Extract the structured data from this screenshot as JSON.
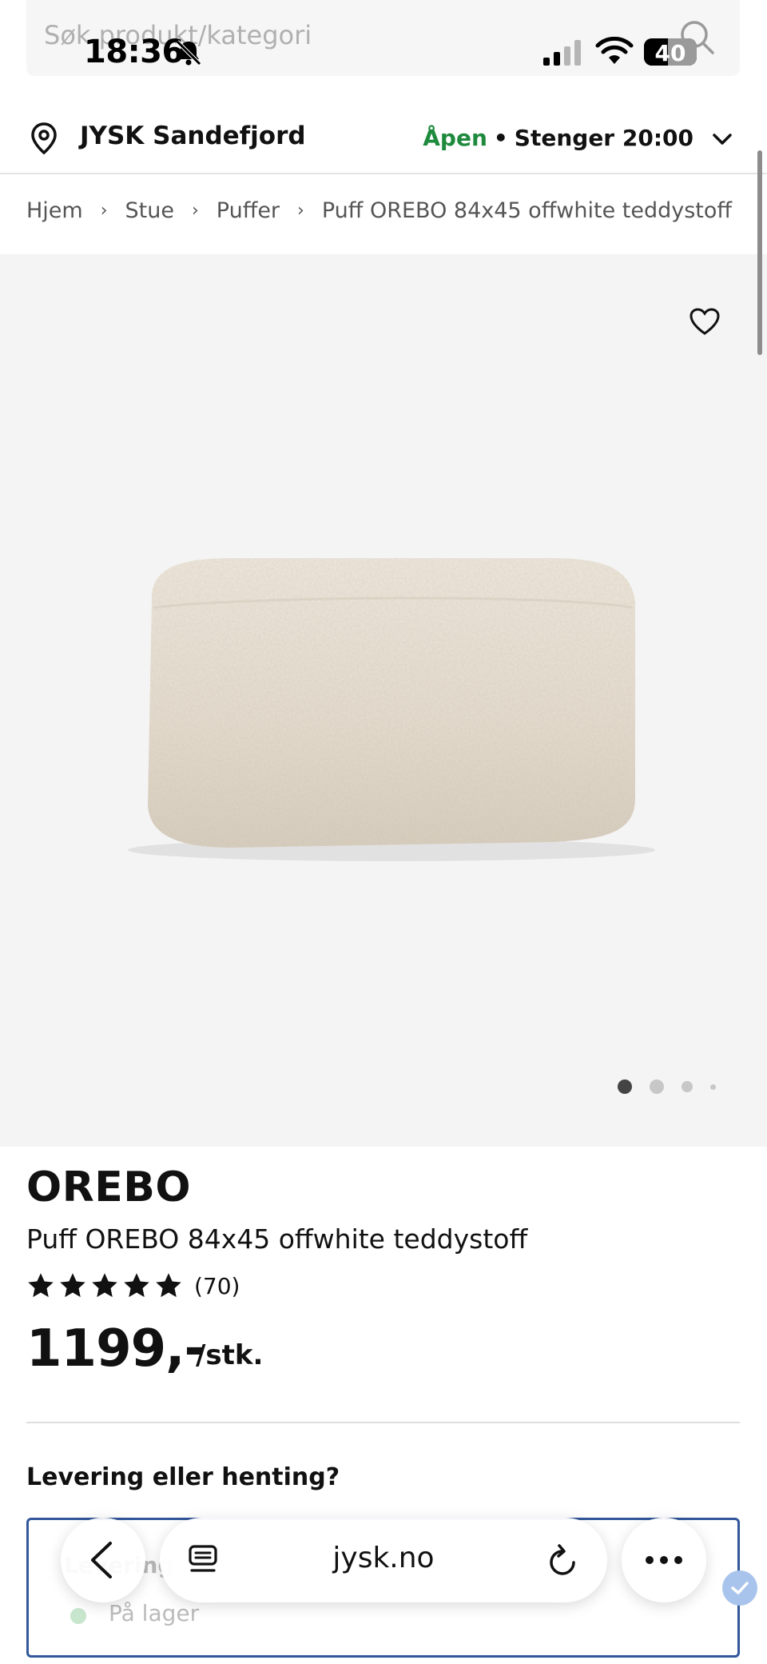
{
  "status_bar": {
    "time": "18:36",
    "battery_level": "40"
  },
  "search": {
    "placeholder": "Søk produkt/kategori"
  },
  "store": {
    "name": "JYSK Sandefjord",
    "open_label": "Åpen",
    "separator": "•",
    "closes_label": "Stenger 20:00"
  },
  "breadcrumb": {
    "items": [
      "Hjem",
      "Stue",
      "Puffer",
      "Puff OREBO 84x45 offwhite teddystoff"
    ],
    "separator": "›"
  },
  "gallery": {
    "image_count": 4,
    "active_index": 0
  },
  "product": {
    "brand": "OREBO",
    "name": "Puff OREBO 84x45 offwhite teddystoff",
    "rating_stars": 5,
    "review_count": "(70)",
    "price": "1199,-",
    "unit": "/stk."
  },
  "delivery": {
    "heading": "Levering eller henting?",
    "card_title": "Levering",
    "stock_label": "På lager"
  },
  "browser": {
    "url": "jysk.no"
  },
  "colors": {
    "open_green": "#1e8a3d",
    "card_border": "#32579b",
    "image_bg": "#f4f4f4",
    "pouf": "#ebe3d6"
  }
}
